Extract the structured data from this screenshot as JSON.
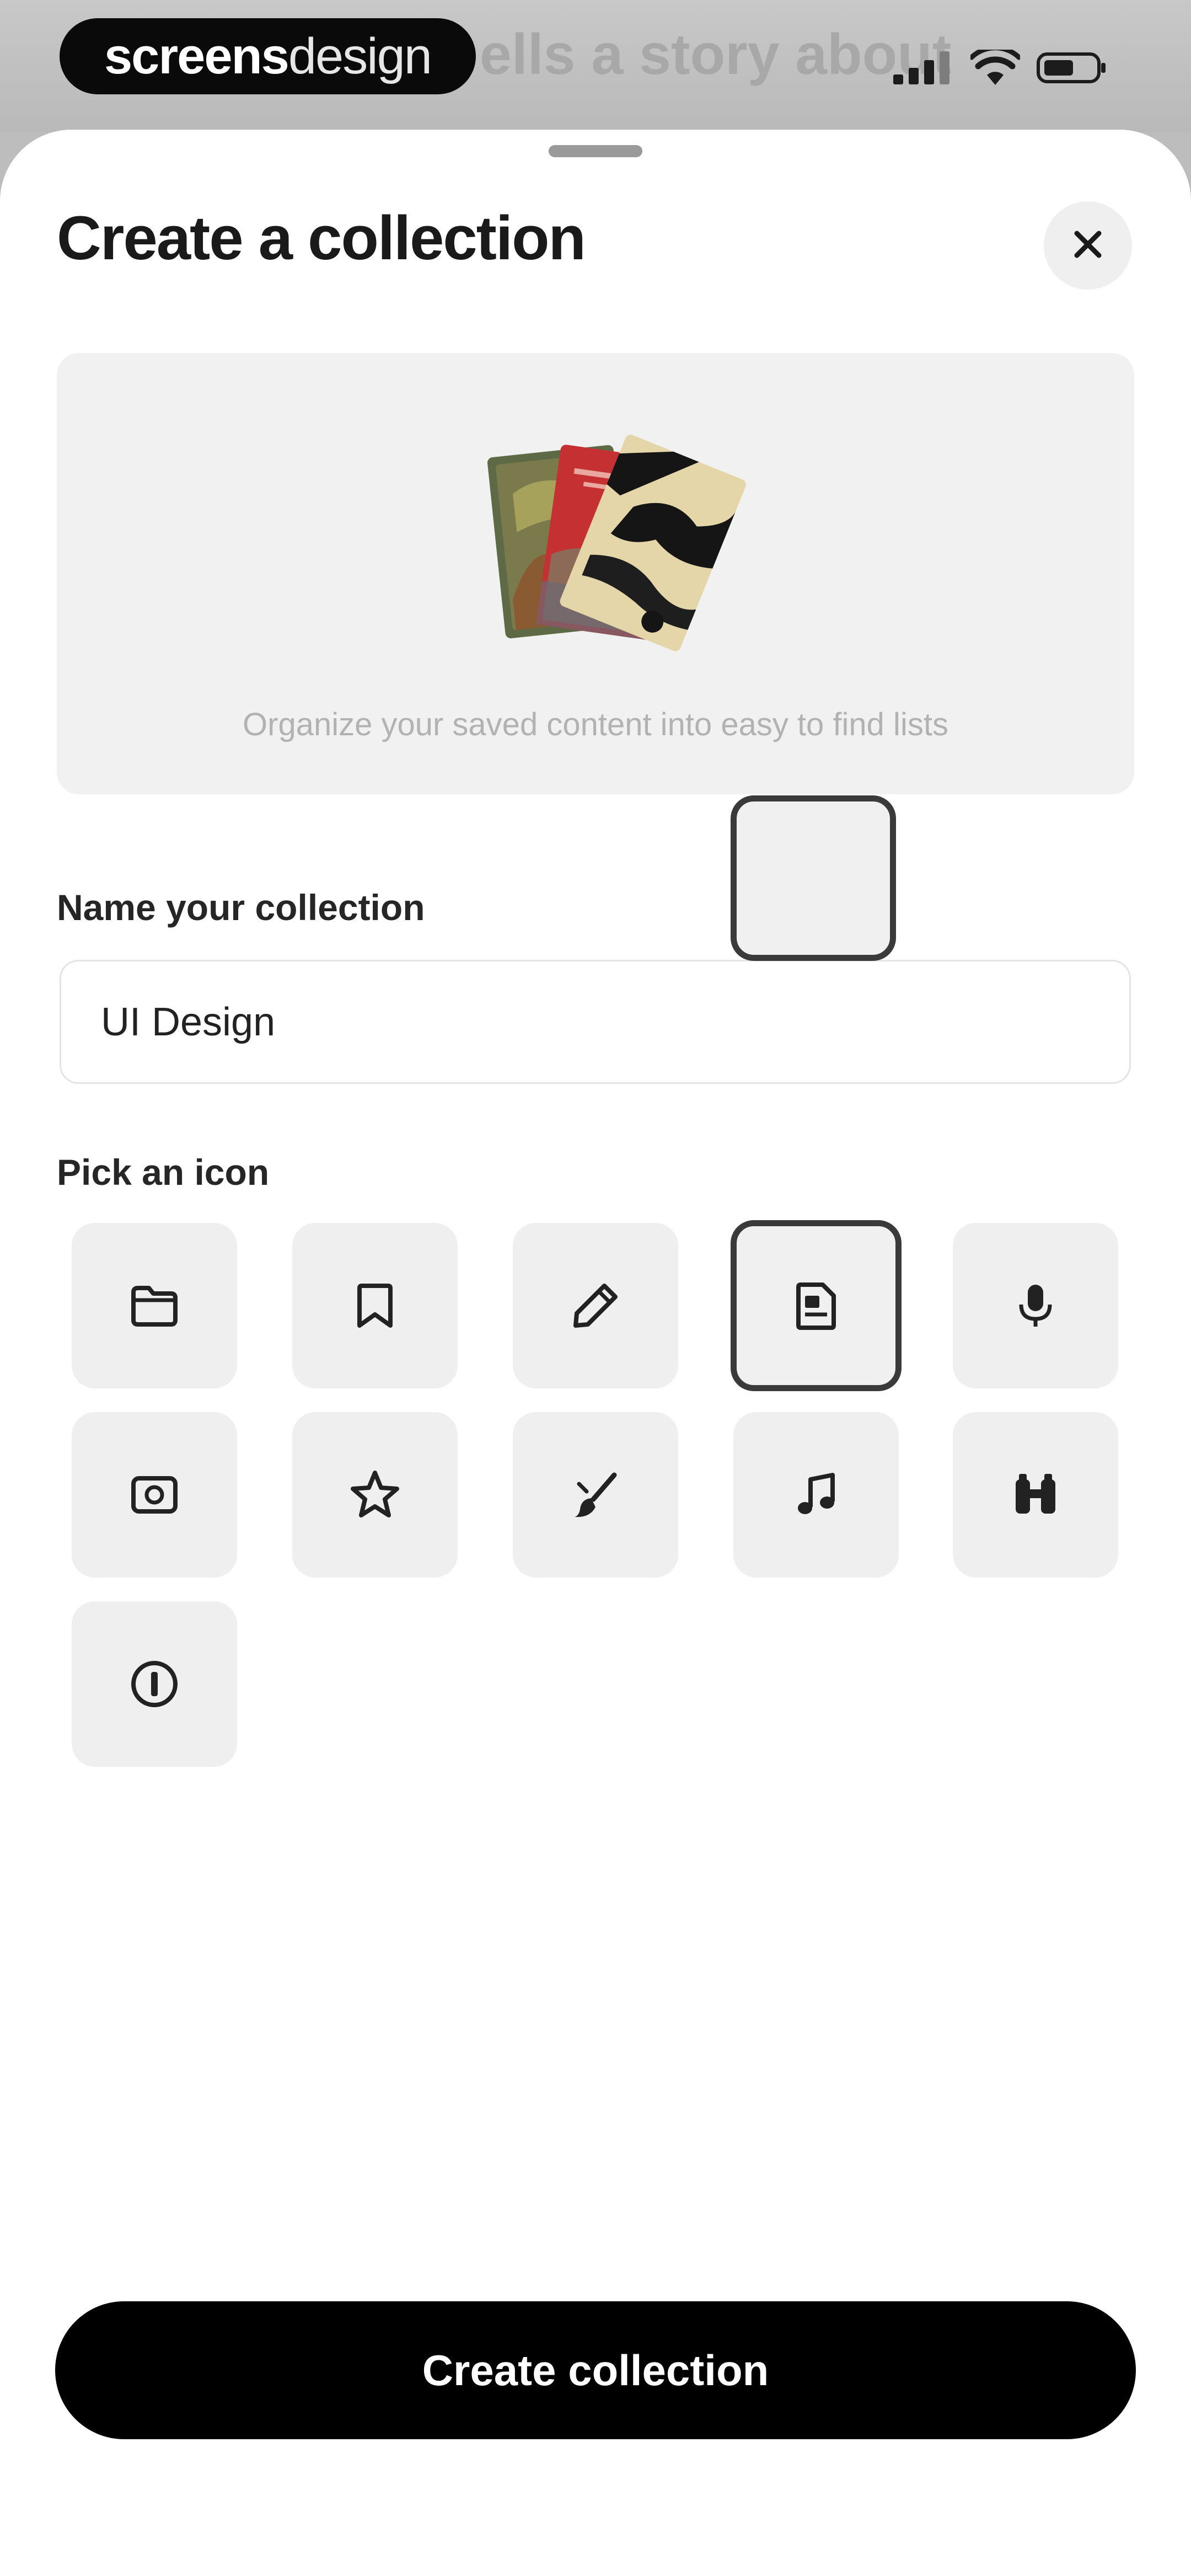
{
  "status_bar": {
    "brand_bold": "screens",
    "brand_light": "design",
    "background_text": "ells a story about"
  },
  "sheet": {
    "title": "Create a collection",
    "close_icon": "close-icon"
  },
  "hero": {
    "caption": "Organize your saved content into easy to find lists"
  },
  "name_field": {
    "label": "Name your collection",
    "value": "UI Design"
  },
  "icon_picker": {
    "label": "Pick an icon",
    "selected": "document-icon",
    "icons": [
      "folder-icon",
      "bookmark-icon",
      "pencil-icon",
      "document-icon",
      "microphone-icon",
      "photo-icon",
      "star-icon",
      "brush-icon",
      "music-note-icon",
      "binoculars-icon",
      "coin-icon"
    ]
  },
  "cta": {
    "label": "Create collection"
  },
  "colors": {
    "primary_button": "#000000",
    "tile_background": "#efefef",
    "selected_border": "#3a3a3a"
  }
}
